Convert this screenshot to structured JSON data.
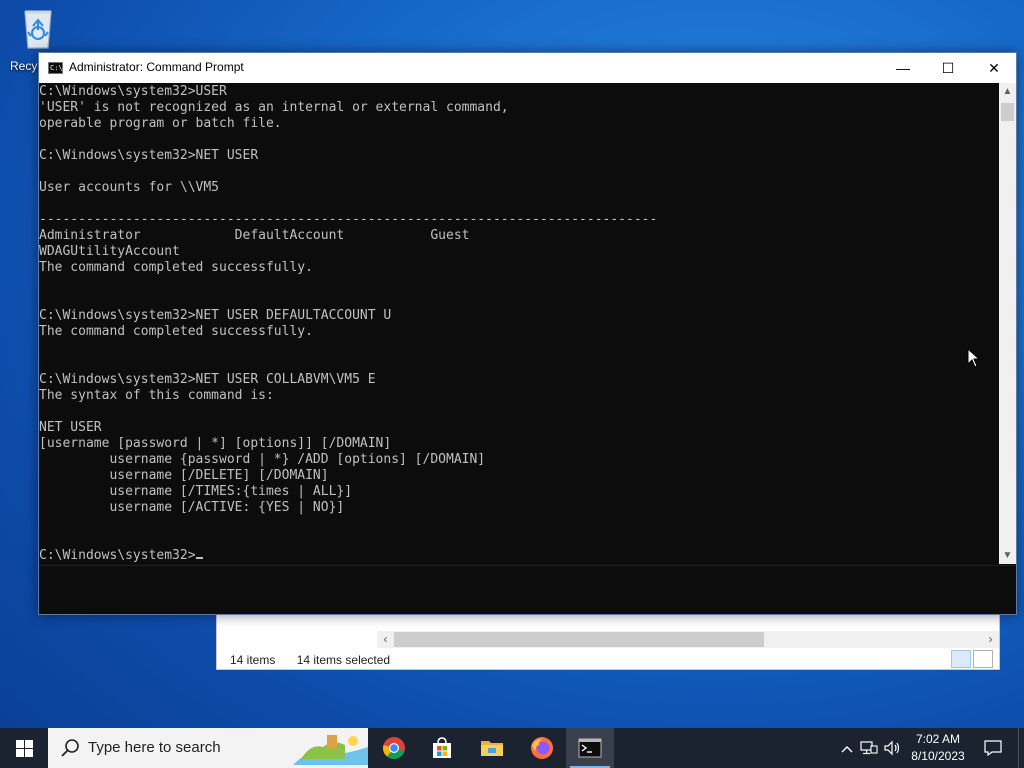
{
  "desktop": {
    "recycle_bin_label": "Recyc"
  },
  "explorer": {
    "status_items": "14 items",
    "status_selected": "14 items selected"
  },
  "cmd": {
    "title": "Administrator: Command Prompt",
    "controls": {
      "minimize": "—",
      "maximize": "☐",
      "close": "✕"
    },
    "lines": [
      "C:\\Windows\\system32>USER",
      "'USER' is not recognized as an internal or external command,",
      "operable program or batch file.",
      "",
      "C:\\Windows\\system32>NET USER",
      "",
      "User accounts for \\\\VM5",
      "",
      "-------------------------------------------------------------------------------",
      "Administrator            DefaultAccount           Guest",
      "WDAGUtilityAccount",
      "The command completed successfully.",
      "",
      "",
      "C:\\Windows\\system32>NET USER DEFAULTACCOUNT U",
      "The command completed successfully.",
      "",
      "",
      "C:\\Windows\\system32>NET USER COLLABVM\\VM5 E",
      "The syntax of this command is:",
      "",
      "NET USER",
      "[username [password | *] [options]] [/DOMAIN]",
      "         username {password | *} /ADD [options] [/DOMAIN]",
      "         username [/DELETE] [/DOMAIN]",
      "         username [/TIMES:{times | ALL}]",
      "         username [/ACTIVE: {YES | NO}]",
      "",
      "",
      "C:\\Windows\\system32>"
    ]
  },
  "taskbar": {
    "search_placeholder": "Type here to search",
    "apps": [
      "chrome-icon",
      "store-icon",
      "file-explorer-icon",
      "firefox-icon",
      "command-prompt-icon"
    ],
    "time": "7:02 AM",
    "date": "8/10/2023"
  },
  "colors": {
    "console_bg": "#0c0c0c",
    "console_fg": "#c0c0c0",
    "taskbar_bg": "#1b2330",
    "desktop_blue": "#1668c8"
  }
}
